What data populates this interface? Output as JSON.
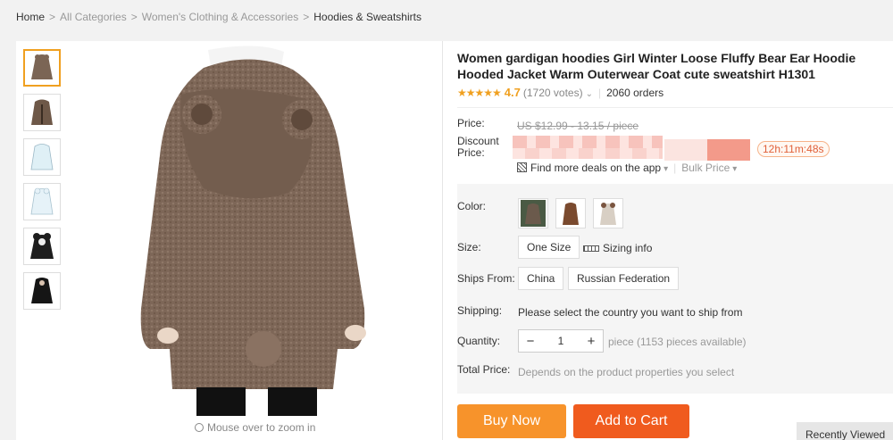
{
  "breadcrumb": {
    "items": [
      "Home",
      "All Categories",
      "Women's Clothing & Accessories",
      "Hoodies & Sweatshirts"
    ],
    "separator": ">"
  },
  "gallery": {
    "thumb_colors": [
      "#7b6555",
      "#6e5848",
      "#dff0f6",
      "#e6f2f8",
      "#1e1e1e",
      "#151515"
    ],
    "zoom_hint": "Mouse over to zoom in"
  },
  "product": {
    "title": "Women gardigan hoodies Girl Winter Loose Fluffy Bear Ear Hoodie Hooded Jacket Warm Outerwear Coat cute sweatshirt H1301",
    "stars": "★★★★★",
    "rating": "4.7",
    "votes": "(1720 votes)",
    "orders": "2060 orders"
  },
  "pricing": {
    "price_label": "Price:",
    "original_price": "US $12.99 - 13.15 / piece",
    "discount_label": "Discount Price:",
    "timer": "12h:11m:48s",
    "app_deals": "Find more deals on the app",
    "bulk_price": "Bulk Price"
  },
  "options": {
    "color_label": "Color:",
    "swatch_colors": [
      "#4a5a44",
      "#7a4a2e",
      "#d8cfc4"
    ],
    "size_label": "Size:",
    "size_value": "One Size",
    "sizing_info": "Sizing info",
    "ships_from_label": "Ships From:",
    "ships_from": [
      "China",
      "Russian Federation"
    ],
    "shipping_label": "Shipping:",
    "shipping_text": "Please select the country you want to ship from",
    "quantity_label": "Quantity:",
    "quantity_minus": "−",
    "quantity_value": "1",
    "quantity_plus": "+",
    "available": "piece (1153 pieces available)",
    "total_label": "Total Price:",
    "total_text": "Depends on the product properties you select"
  },
  "actions": {
    "buy_now": "Buy Now",
    "add_to_cart": "Add to Cart",
    "recently_viewed": "Recently Viewed"
  },
  "colors": {
    "accent_orange": "#f7932b",
    "cart_red": "#f05b1e",
    "star": "#f0a020",
    "hoodie": "#7d6657"
  }
}
